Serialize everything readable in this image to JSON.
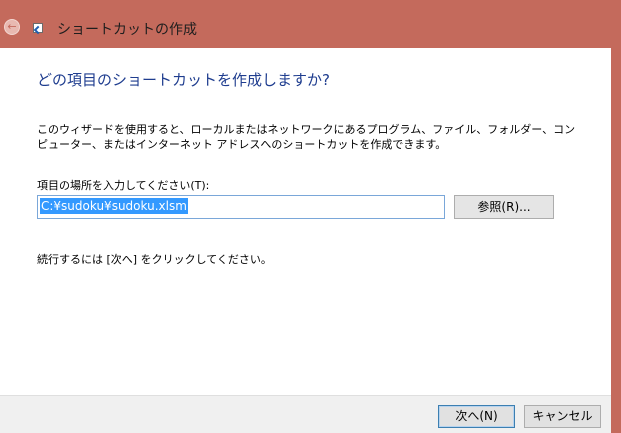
{
  "window": {
    "title": "ショートカットの作成",
    "back_icon": "back-arrow-icon",
    "app_icon": "shortcut-icon"
  },
  "main": {
    "heading": "どの項目のショートカットを作成しますか?",
    "description": "このウィザードを使用すると、ローカルまたはネットワークにあるプログラム、ファイル、フォルダー、コンピューター、またはインターネット アドレスへのショートカットを作成できます。",
    "location_label": "項目の場所を入力してください(T):",
    "location_value": "C:¥sudoku¥sudoku.xlsm",
    "browse_label": "参照(R)...",
    "continue_text": "続行するには [次へ] をクリックしてください。"
  },
  "footer": {
    "next_label": "次へ(N)",
    "cancel_label": "キャンセル"
  },
  "colors": {
    "title_bar": "#c46a5c",
    "heading": "#1f3d8f",
    "selection": "#3399ff"
  }
}
